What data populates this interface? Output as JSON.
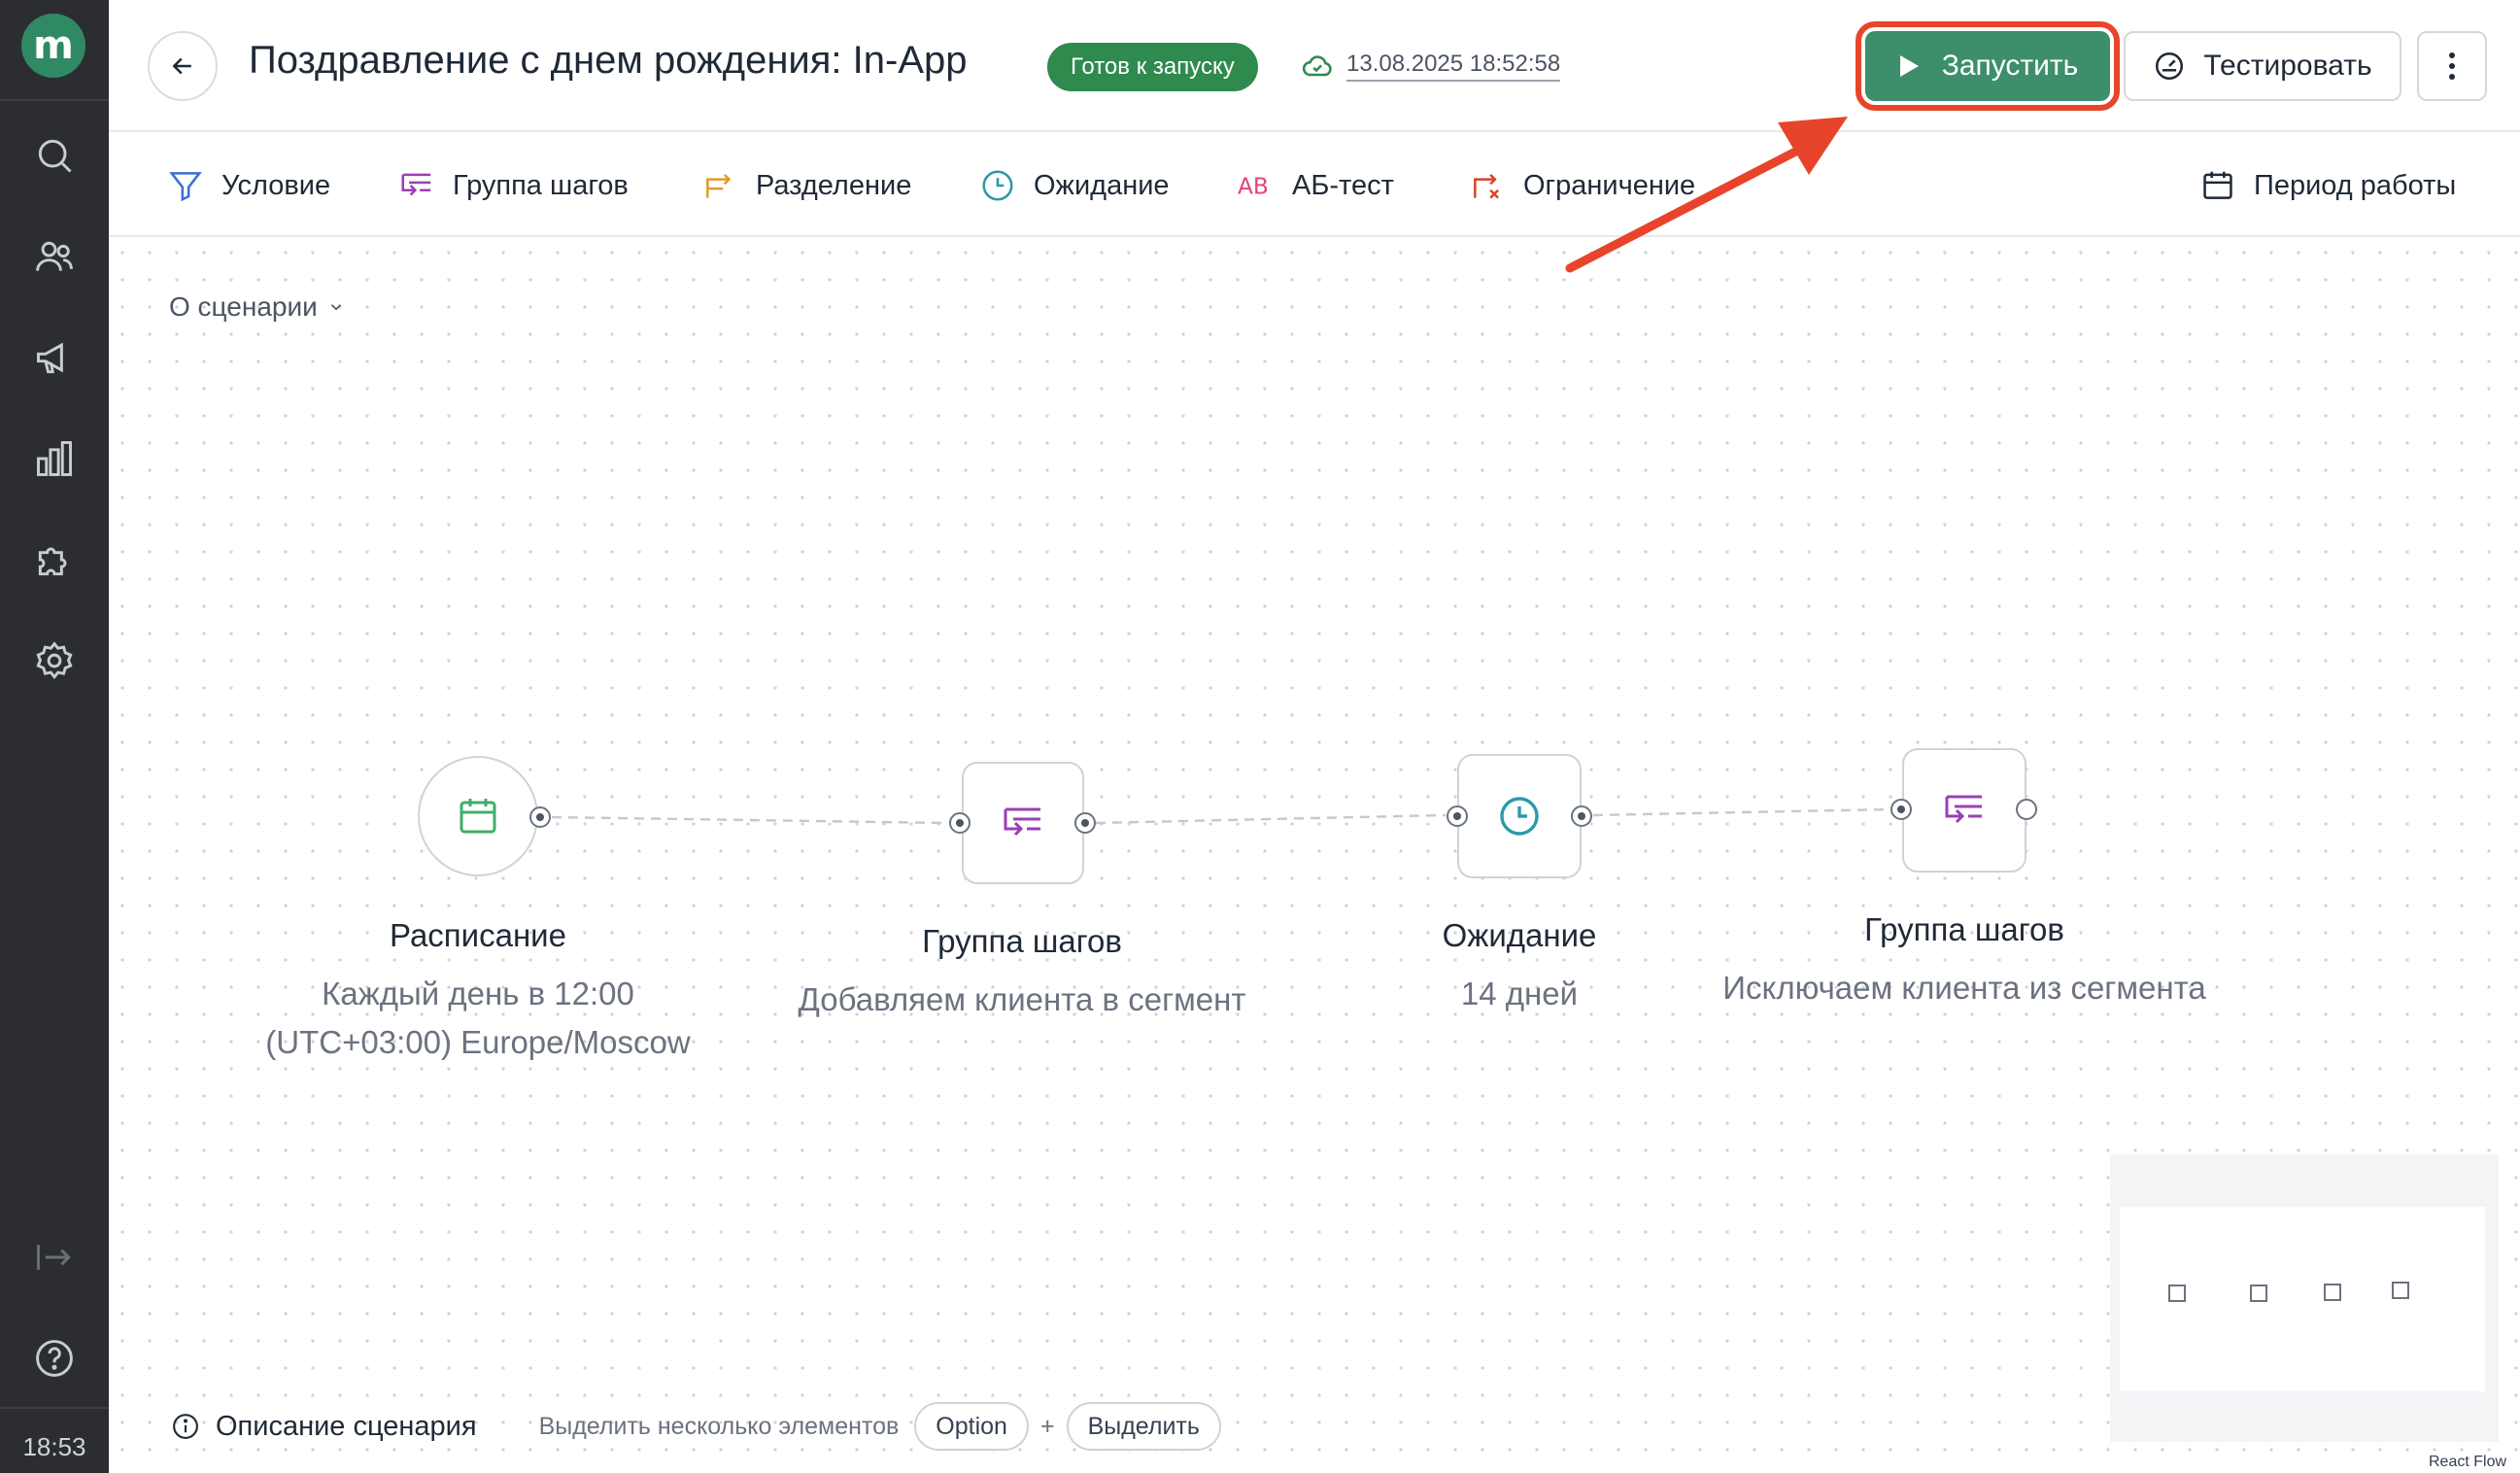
{
  "sidebar": {
    "logo": "m",
    "time": "18:53",
    "icons": [
      "search-icon",
      "users-icon",
      "megaphone-icon",
      "chart-icon",
      "puzzle-icon",
      "gear-icon",
      "collapse-icon",
      "help-icon"
    ]
  },
  "header": {
    "title": "Поздравление с днем рождения: In-App",
    "status": "Готов к запуску",
    "saved_at": "13.08.2025 18:52:58",
    "launch_label": "Запустить",
    "test_label": "Тестировать"
  },
  "toolbar": {
    "items": [
      {
        "label": "Условие",
        "icon": "filter-icon",
        "color": "#3b6fd6"
      },
      {
        "label": "Группа шагов",
        "icon": "steps-icon",
        "color": "#9b3fb6"
      },
      {
        "label": "Разделение",
        "icon": "split-icon",
        "color": "#e39b2a"
      },
      {
        "label": "Ожидание",
        "icon": "clock-icon",
        "color": "#2b9aa8"
      },
      {
        "label": "АБ-тест",
        "icon": "ab-icon",
        "color": "#e0457b"
      },
      {
        "label": "Ограничение",
        "icon": "limit-icon",
        "color": "#d8452b"
      }
    ],
    "period_label": "Период работы"
  },
  "canvas": {
    "about_label": "О сценарии",
    "nodes": [
      {
        "title": "Расписание",
        "subtitle_lines": [
          "Каждый день в 12:00",
          "(UTC+03:00) Europe/Moscow"
        ],
        "icon": "calendar-icon"
      },
      {
        "title": "Группа шагов",
        "subtitle_lines": [
          "Добавляем клиента в сегмент"
        ],
        "icon": "steps-icon"
      },
      {
        "title": "Ожидание",
        "subtitle_lines": [
          "14 дней"
        ],
        "icon": "clock-icon"
      },
      {
        "title": "Группа шагов",
        "subtitle_lines": [
          "Исключаем клиента из сегмента"
        ],
        "icon": "steps-icon"
      }
    ]
  },
  "bottom": {
    "description_label": "Описание сценария",
    "hint": "Выделить несколько элементов",
    "key1": "Option",
    "plus": "+",
    "key2": "Выделить"
  },
  "attribution": "React Flow",
  "colors": {
    "accent_green": "#3c8f6a",
    "badge_green": "#2f8a4e",
    "highlight_red": "#e8442b",
    "sidebar_bg": "#2b2d31"
  }
}
